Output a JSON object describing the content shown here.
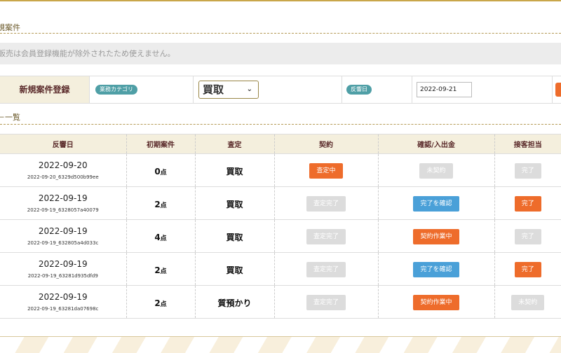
{
  "sections": {
    "register_title": "規案件",
    "list_title": "一覧"
  },
  "notice": "販売は会員登録機能が除外されたため使えません。",
  "registration": {
    "label": "新規案件登録",
    "category_tag": "業務カテゴリ",
    "category_value": "買取",
    "response_tag": "反響日",
    "response_date": "2022-09-21"
  },
  "table": {
    "headers": [
      "反響日",
      "初期案件",
      "査定",
      "契約",
      "確認/入出金",
      "接客担当"
    ],
    "count_unit": "点",
    "rows": [
      {
        "date": "2022-09-20",
        "id": "2022-09-20_6329d500b99ee",
        "count": "0",
        "assess": "買取",
        "contract": {
          "label": "査定中",
          "color": "orange"
        },
        "confirm": {
          "label": "未契約",
          "color": "gray"
        },
        "staff": {
          "label": "完了",
          "color": "gray"
        }
      },
      {
        "date": "2022-09-19",
        "id": "2022-09-19_6328057a40079",
        "count": "2",
        "assess": "買取",
        "contract": {
          "label": "査定完了",
          "color": "gray"
        },
        "confirm": {
          "label": "完了を確認",
          "color": "blue"
        },
        "staff": {
          "label": "完了",
          "color": "orange"
        }
      },
      {
        "date": "2022-09-19",
        "id": "2022-09-19_632805a4d033c",
        "count": "4",
        "assess": "買取",
        "contract": {
          "label": "査定完了",
          "color": "gray"
        },
        "confirm": {
          "label": "契約作業中",
          "color": "orange"
        },
        "staff": {
          "label": "完了",
          "color": "gray"
        }
      },
      {
        "date": "2022-09-19",
        "id": "2022-09-19_63281d935dfd9",
        "count": "2",
        "assess": "買取",
        "contract": {
          "label": "査定完了",
          "color": "gray"
        },
        "confirm": {
          "label": "完了を確認",
          "color": "blue"
        },
        "staff": {
          "label": "完了",
          "color": "orange"
        }
      },
      {
        "date": "2022-09-19",
        "id": "2022-09-19_63281da07698c",
        "count": "2",
        "assess": "質預かり",
        "contract": {
          "label": "査定完了",
          "color": "gray"
        },
        "confirm": {
          "label": "契約作業中",
          "color": "orange"
        },
        "staff": {
          "label": "未契約",
          "color": "gray"
        }
      }
    ]
  },
  "colors": {
    "orange": "#ee6c2b",
    "blue": "#4aa0d8",
    "gray": "#dcdcdc",
    "teal_tag": "#4f9fa6",
    "header_bg": "#f4efdd"
  }
}
